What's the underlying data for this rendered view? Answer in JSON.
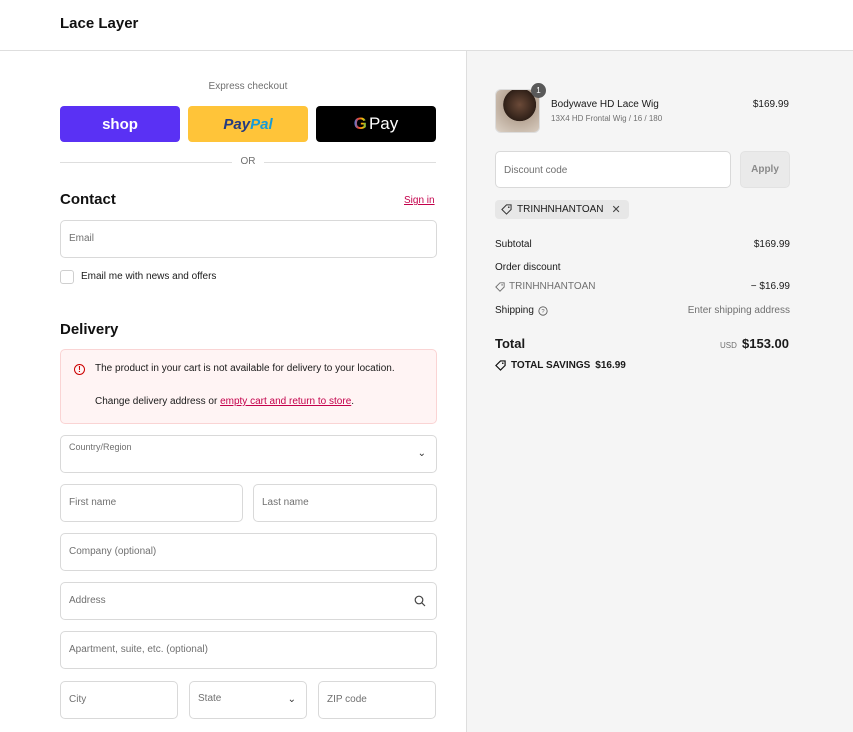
{
  "header": {
    "brand": "Lace Layer"
  },
  "express": {
    "label": "Express checkout",
    "shop_label": "shop",
    "paypal_pay": "Pay",
    "paypal_pal": "Pal",
    "gpay_g": "G",
    "gpay_label": "Pay",
    "or_label": "OR"
  },
  "contact": {
    "title": "Contact",
    "sign_in": "Sign in",
    "email_placeholder": "Email",
    "newsletter_label": "Email me with news and offers"
  },
  "delivery": {
    "title": "Delivery",
    "error_title": "The product in your cart is not available for delivery to your location.",
    "error_prefix": "Change delivery address or ",
    "error_link": "empty cart and return to store",
    "error_suffix": ".",
    "country_label": "Country/Region",
    "first_name": "First name",
    "last_name": "Last name",
    "company": "Company (optional)",
    "address": "Address",
    "apartment": "Apartment, suite, etc. (optional)",
    "city": "City",
    "state": "State",
    "zip": "ZIP code"
  },
  "cart": {
    "item": {
      "quantity": "1",
      "name": "Bodywave HD Lace Wig",
      "variant": "13X4 HD Frontal Wig / 16 / 180",
      "price": "$169.99"
    },
    "discount_placeholder": "Discount code",
    "apply_label": "Apply",
    "applied_code": "TRINHNHANTOAN",
    "subtotal_label": "Subtotal",
    "subtotal_value": "$169.99",
    "order_discount_label": "Order discount",
    "order_discount_code": "TRINHNHANTOAN",
    "order_discount_value": "− $16.99",
    "shipping_label": "Shipping",
    "shipping_value": "Enter shipping address",
    "total_label": "Total",
    "currency": "USD",
    "total_value": "$153.00",
    "savings_label": "TOTAL SAVINGS",
    "savings_value": "$16.99"
  },
  "colors": {
    "shop": "#5a31f4",
    "paypal": "#ffc439",
    "gpay": "#000000",
    "accent_link": "#c4004b",
    "error_bg": "#fff4f4"
  }
}
